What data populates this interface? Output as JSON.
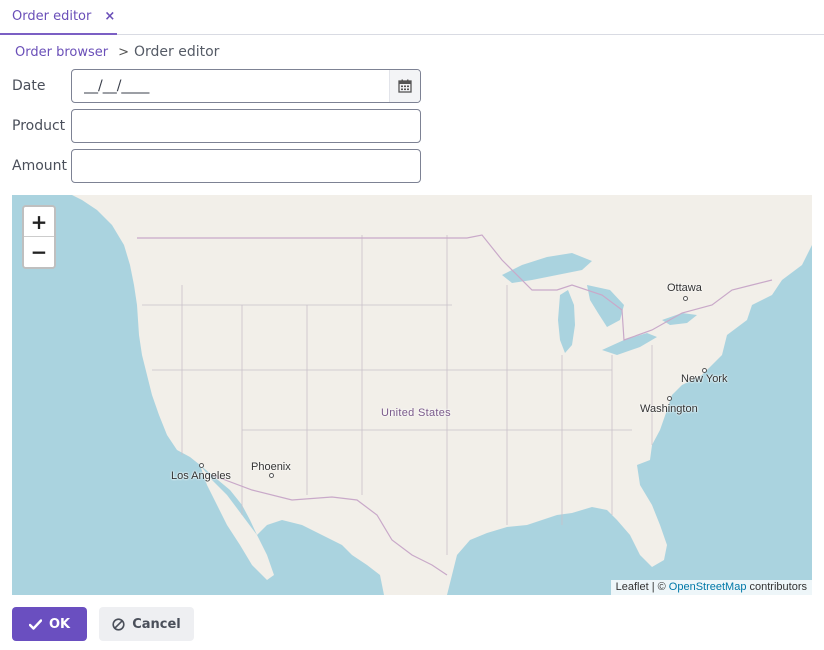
{
  "tab": {
    "label": "Order editor",
    "close_glyph": "×"
  },
  "breadcrumb": {
    "parent": "Order browser",
    "separator": ">",
    "current": "Order editor"
  },
  "form": {
    "date": {
      "label": "Date",
      "value": "__/__/____"
    },
    "product": {
      "label": "Product",
      "value": ""
    },
    "amount": {
      "label": "Amount",
      "value": ""
    }
  },
  "map": {
    "zoom_in": "+",
    "zoom_out": "−",
    "labels": {
      "country": "United States",
      "ottawa": "Ottawa",
      "new_york": "New York",
      "washington": "Washington",
      "los_angeles": "Los Angeles",
      "phoenix": "Phoenix"
    },
    "attribution": {
      "leaflet": "Leaflet",
      "sep": "| ©",
      "osm": "OpenStreetMap",
      "contributors": "contributors"
    },
    "colors": {
      "water": "#aad3df",
      "land": "#f2efe9",
      "border": "#c9a9c9"
    }
  },
  "buttons": {
    "ok": "OK",
    "cancel": "Cancel"
  },
  "colors": {
    "accent": "#6a4fc0"
  }
}
